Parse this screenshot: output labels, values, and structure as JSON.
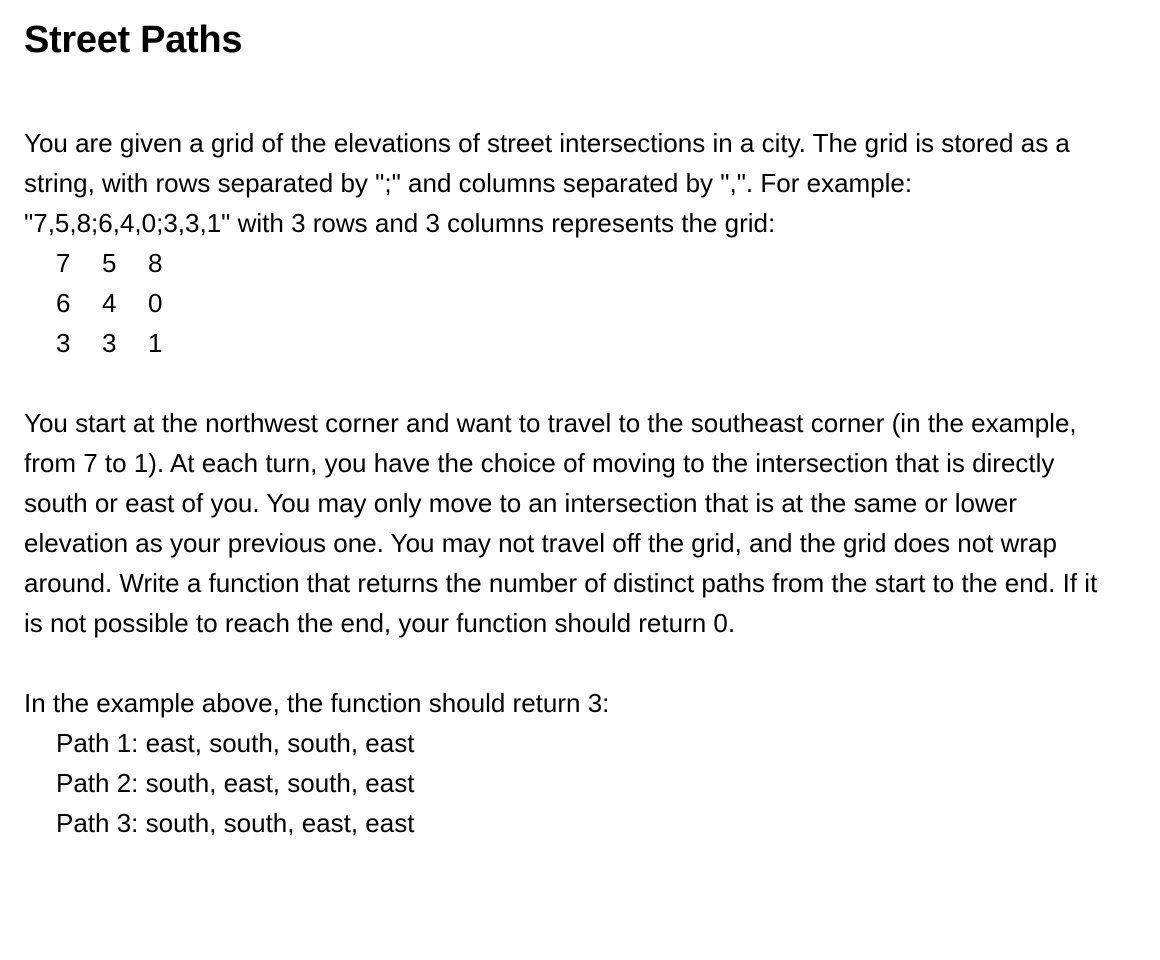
{
  "document": {
    "title": "Street Paths",
    "intro": "You are given a grid of the elevations of street intersections in a city. The grid is stored as a string, with rows separated by \";\" and columns separated by \",\". For example: \"7,5,8;6,4,0;3,3,1\" with 3 rows and 3 columns represents the grid:",
    "grid": [
      [
        "7",
        "5",
        "8"
      ],
      [
        "6",
        "4",
        "0"
      ],
      [
        "3",
        "3",
        "1"
      ]
    ],
    "rules": "You start at the northwest corner and want to travel to the southeast corner (in the example, from 7 to 1). At each turn, you have the choice of moving to the intersection that is directly south or east of you. You may only move to an intersection that is at the same or lower elevation as your previous one. You may not travel off the grid, and the grid does not wrap around. Write a function that returns the number of distinct paths from the start to the end. If it is not possible to reach the end, your function should return 0.",
    "answer_intro": "In the example above, the function should return 3:",
    "paths": [
      "Path 1: east, south, south, east",
      "Path 2: south, east, south, east",
      "Path 3: south, south, east, east"
    ]
  }
}
